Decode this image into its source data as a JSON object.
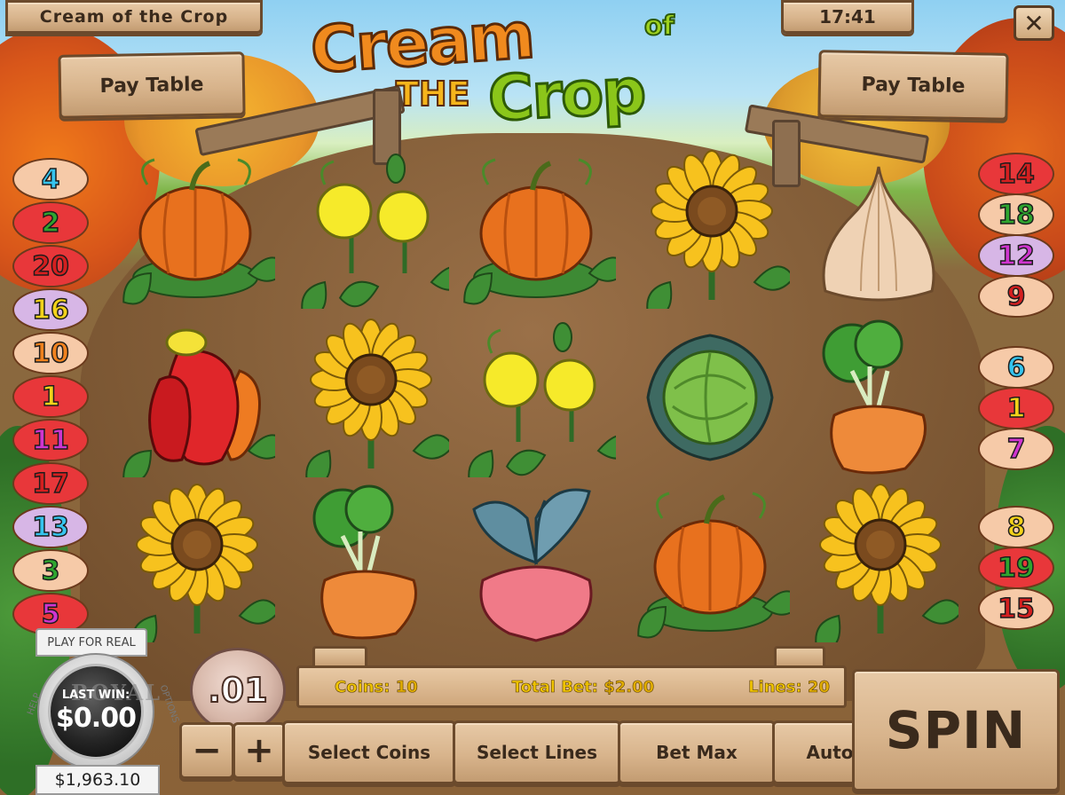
{
  "header": {
    "title": "Cream of the Crop",
    "clock": "17:41",
    "close_glyph": "✕",
    "paytable_left": "Pay Table",
    "paytable_right": "Pay Table"
  },
  "logo": {
    "line1": "Cream",
    "of": "of",
    "the": "THE",
    "line2": "Crop"
  },
  "line_markers": {
    "left": [
      "4",
      "2",
      "20",
      "16",
      "10",
      "1",
      "11",
      "17",
      "13",
      "3",
      "5"
    ],
    "right_top": [
      "14",
      "18",
      "12",
      "9"
    ],
    "right_middle": [
      "6",
      "1",
      "7"
    ],
    "right_bottom": [
      "8",
      "19",
      "15"
    ]
  },
  "reels": [
    [
      "pumpkin-icon",
      "dandelion-icon",
      "pumpkin-icon",
      "sunflower-icon",
      "onion-icon"
    ],
    [
      "pepper-icon",
      "sunflower-icon",
      "dandelion-icon",
      "cabbage-icon",
      "carrot-icon"
    ],
    [
      "sunflower-icon",
      "carrot-icon",
      "radish-icon",
      "pumpkin-icon",
      "sunflower-icon"
    ]
  ],
  "info_bar": {
    "coins_label": "Coins:",
    "coins_value": "10",
    "total_bet_label": "Total Bet:",
    "total_bet_value": "$2.00",
    "lines_label": "Lines:",
    "lines_value": "20"
  },
  "controls": {
    "coin_value": ".01",
    "minus": "−",
    "plus": "+",
    "select_coins": "Select Coins",
    "select_lines": "Select Lines",
    "bet_max": "Bet Max",
    "auto": "Auto",
    "spin": "SPIN"
  },
  "badge": {
    "play_for_real": "PLAY FOR REAL",
    "last_win_label": "LAST WIN:",
    "last_win_value": "$0.00",
    "help": "HELP",
    "options": "OPTIONS",
    "brand": "ROYAL",
    "balance": "$1,963.10"
  },
  "colors": {
    "marker_red": "#e8373a",
    "marker_peach": "#f6caa8",
    "marker_lilac": "#d7b6e6",
    "text_cyan": "#35c4ee",
    "text_green": "#2fa52f",
    "text_red": "#d41f1f",
    "text_yellow": "#f3d21a",
    "text_orange": "#f0821e",
    "text_magenta": "#cf35cf"
  }
}
